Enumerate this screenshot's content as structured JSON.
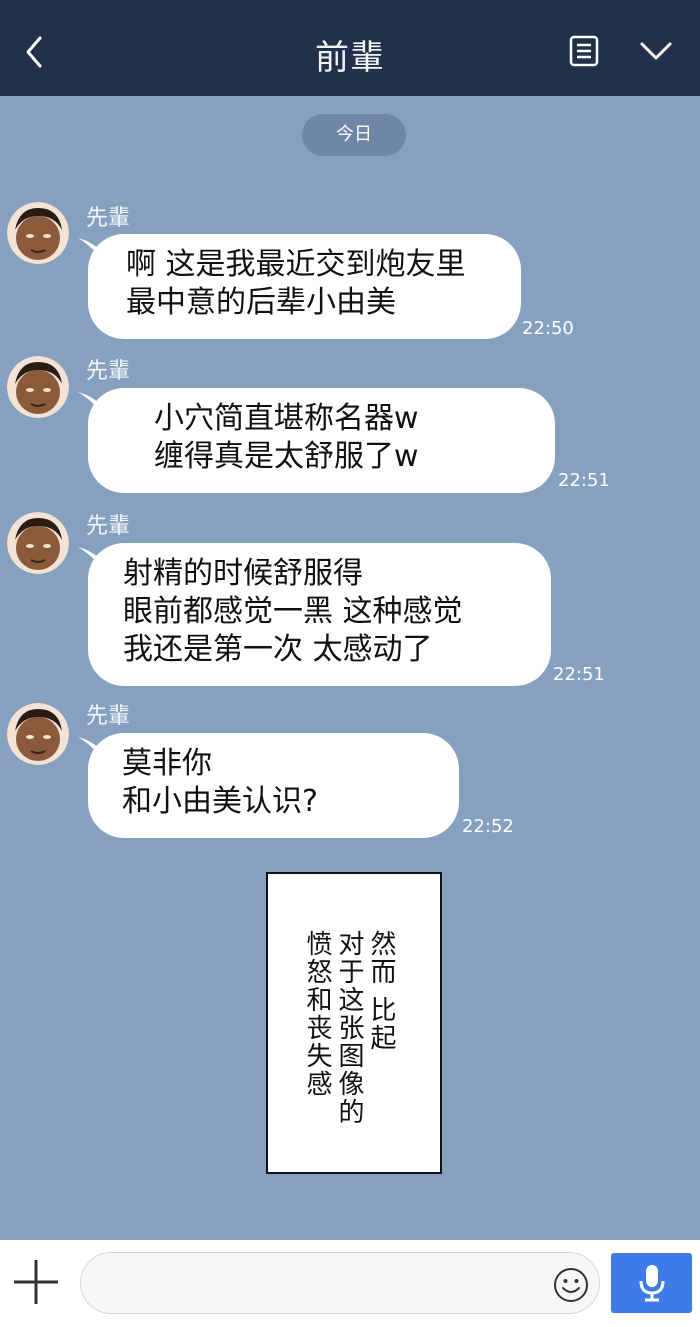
{
  "header": {
    "title": "前輩",
    "back_icon": "chevron-left-icon",
    "menu_icon": "notes-icon",
    "dropdown_icon": "chevron-down-icon"
  },
  "date_divider": "今日",
  "messages": [
    {
      "sender": "先輩",
      "text": "啊 这是我最近交到炮友里\n最中意的后辈小由美",
      "time": "22:50"
    },
    {
      "sender": "先輩",
      "text": "小穴简直堪称名器w\n缠得真是太舒服了w",
      "time": "22:51"
    },
    {
      "sender": "先輩",
      "text": "射精的时候舒服得\n眼前都感觉一黑 这种感觉\n我还是第一次 太感动了",
      "time": "22:51"
    },
    {
      "sender": "先輩",
      "text": "莫非你\n和小由美认识?",
      "time": "22:52"
    }
  ],
  "narration": {
    "col1": "然而 比起",
    "col2": "对于这张图像的",
    "col3": "愤怒和丧失感"
  },
  "input": {
    "value": "",
    "placeholder": ""
  },
  "colors": {
    "header_bg": "#23304a",
    "chat_bg": "#86a1c0",
    "bubble_bg": "#ffffff",
    "mic_button": "#3f7be8"
  }
}
